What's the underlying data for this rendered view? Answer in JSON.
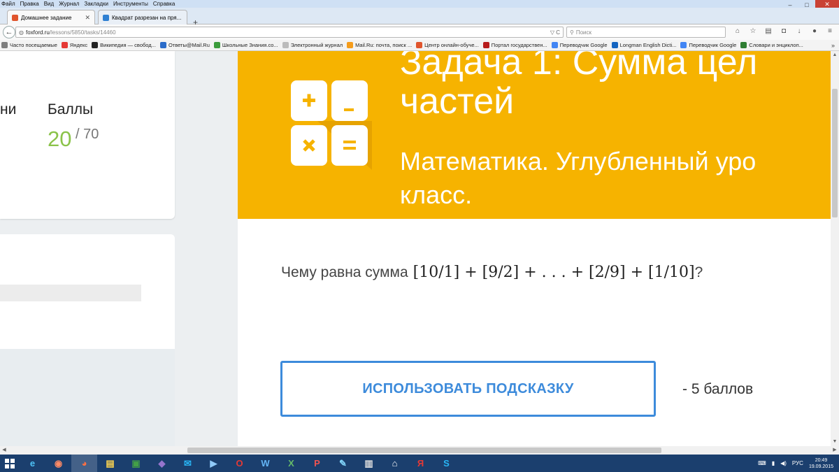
{
  "menu": [
    "Файл",
    "Правка",
    "Вид",
    "Журнал",
    "Закладки",
    "Инструменты",
    "Справка"
  ],
  "window_controls": {
    "minimize": "–",
    "maximize": "□",
    "close": "✕"
  },
  "tabs": [
    {
      "title": "Домашнее задание",
      "active": true,
      "color": "#e0552d"
    },
    {
      "title": "Квадрат разрезан на пря...",
      "active": false,
      "color": "#2e7fd2"
    }
  ],
  "address": {
    "host": "foxford.ru",
    "path": "/lessons/5850/tasks/14460"
  },
  "search": {
    "placeholder": "Поиск"
  },
  "bookmarks": [
    {
      "label": "Часто посещаемые",
      "color": "#7d7d7d"
    },
    {
      "label": "Яндекс",
      "color": "#e53935"
    },
    {
      "label": "Википедия — свобод...",
      "color": "#222222"
    },
    {
      "label": "Ответы@Mail.Ru",
      "color": "#2a6bc9"
    },
    {
      "label": "Школьные Знания.co...",
      "color": "#3c9c3c"
    },
    {
      "label": "Электронный журнал",
      "color": "#bbbbbb"
    },
    {
      "label": "Mail.Ru: почта, поиск ...",
      "color": "#f59c1a"
    },
    {
      "label": "Центр онлайн-обуче...",
      "color": "#e0552d"
    },
    {
      "label": "Портал государствен...",
      "color": "#b71c1c"
    },
    {
      "label": "Переводчик Google",
      "color": "#4285f4"
    },
    {
      "label": "Longman English Dicti...",
      "color": "#1565c0"
    },
    {
      "label": "Переводчик Google",
      "color": "#4285f4"
    },
    {
      "label": "Словари и энциклоп...",
      "color": "#2e7d32"
    }
  ],
  "score": {
    "left_label": "ни",
    "label": "Баллы",
    "value": "20",
    "total": "/ 70",
    "value_color": "#8bc34a"
  },
  "task": {
    "title_line1": "Задача 1: Сумма цел",
    "title_line2": "частей",
    "subtitle_line1": "Математика. Углубленный уро",
    "subtitle_line2": "класс.",
    "header_color": "#f6b300",
    "question_text": "Чему равна сумма",
    "question_math": " [10/1] + [9/2] + . . . + [2/9] + [1/10]",
    "question_end": "?",
    "hint_button": "ИСПОЛЬЗОВАТЬ ПОДСКАЗКУ",
    "hint_cost": "- 5 баллов",
    "accent_color": "#3d8bdb"
  },
  "taskbar": {
    "apps": [
      {
        "name": "ie-icon",
        "glyph": "e",
        "color": "#4fc3f7"
      },
      {
        "name": "browser-icon",
        "glyph": "◉",
        "color": "#ff8a65"
      },
      {
        "name": "firefox-icon",
        "glyph": "◕",
        "color": "#ff7043",
        "active": true
      },
      {
        "name": "file-explorer-icon",
        "glyph": "▤",
        "color": "#ffd54f"
      },
      {
        "name": "store-icon",
        "glyph": "▣",
        "color": "#43a047"
      },
      {
        "name": "visual-studio-icon",
        "glyph": "◆",
        "color": "#9575cd"
      },
      {
        "name": "mail-icon",
        "glyph": "✉",
        "color": "#29b6f6"
      },
      {
        "name": "media-player-icon",
        "glyph": "▶",
        "color": "#90caf9"
      },
      {
        "name": "opera-icon",
        "glyph": "O",
        "color": "#e53935"
      },
      {
        "name": "word-icon",
        "glyph": "W",
        "color": "#64b5f6"
      },
      {
        "name": "excel-icon",
        "glyph": "X",
        "color": "#66bb6a"
      },
      {
        "name": "powerpoint-icon",
        "glyph": "P",
        "color": "#ef5350"
      },
      {
        "name": "notes-icon",
        "glyph": "✎",
        "color": "#81d4fa"
      },
      {
        "name": "document-icon",
        "glyph": "▥",
        "color": "#e0e0e0"
      },
      {
        "name": "home-icon",
        "glyph": "⌂",
        "color": "#ffffff"
      },
      {
        "name": "yandex-icon",
        "glyph": "Я",
        "color": "#e53935"
      },
      {
        "name": "skype-icon",
        "glyph": "S",
        "color": "#29b6f6"
      }
    ],
    "lang": "РУС",
    "time": "20:49",
    "date": "19.09.2015"
  }
}
